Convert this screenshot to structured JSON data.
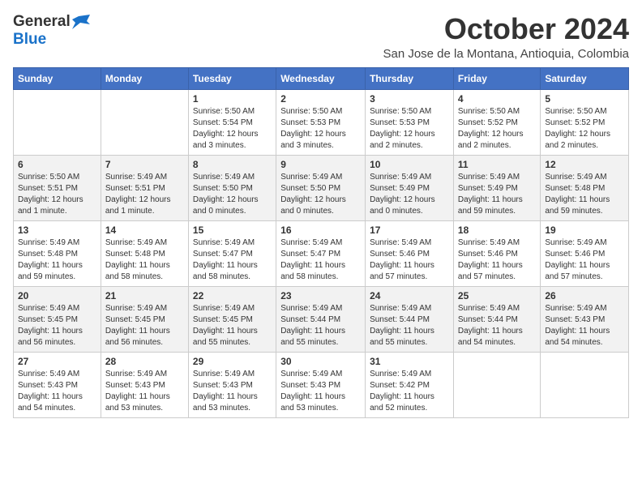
{
  "header": {
    "logo_general": "General",
    "logo_blue": "Blue",
    "month_title": "October 2024",
    "location": "San Jose de la Montana, Antioquia, Colombia"
  },
  "calendar": {
    "days_of_week": [
      "Sunday",
      "Monday",
      "Tuesday",
      "Wednesday",
      "Thursday",
      "Friday",
      "Saturday"
    ],
    "weeks": [
      [
        {
          "day": "",
          "info": ""
        },
        {
          "day": "",
          "info": ""
        },
        {
          "day": "1",
          "info": "Sunrise: 5:50 AM\nSunset: 5:54 PM\nDaylight: 12 hours\nand 3 minutes."
        },
        {
          "day": "2",
          "info": "Sunrise: 5:50 AM\nSunset: 5:53 PM\nDaylight: 12 hours\nand 3 minutes."
        },
        {
          "day": "3",
          "info": "Sunrise: 5:50 AM\nSunset: 5:53 PM\nDaylight: 12 hours\nand 2 minutes."
        },
        {
          "day": "4",
          "info": "Sunrise: 5:50 AM\nSunset: 5:52 PM\nDaylight: 12 hours\nand 2 minutes."
        },
        {
          "day": "5",
          "info": "Sunrise: 5:50 AM\nSunset: 5:52 PM\nDaylight: 12 hours\nand 2 minutes."
        }
      ],
      [
        {
          "day": "6",
          "info": "Sunrise: 5:50 AM\nSunset: 5:51 PM\nDaylight: 12 hours\nand 1 minute."
        },
        {
          "day": "7",
          "info": "Sunrise: 5:49 AM\nSunset: 5:51 PM\nDaylight: 12 hours\nand 1 minute."
        },
        {
          "day": "8",
          "info": "Sunrise: 5:49 AM\nSunset: 5:50 PM\nDaylight: 12 hours\nand 0 minutes."
        },
        {
          "day": "9",
          "info": "Sunrise: 5:49 AM\nSunset: 5:50 PM\nDaylight: 12 hours\nand 0 minutes."
        },
        {
          "day": "10",
          "info": "Sunrise: 5:49 AM\nSunset: 5:49 PM\nDaylight: 12 hours\nand 0 minutes."
        },
        {
          "day": "11",
          "info": "Sunrise: 5:49 AM\nSunset: 5:49 PM\nDaylight: 11 hours\nand 59 minutes."
        },
        {
          "day": "12",
          "info": "Sunrise: 5:49 AM\nSunset: 5:48 PM\nDaylight: 11 hours\nand 59 minutes."
        }
      ],
      [
        {
          "day": "13",
          "info": "Sunrise: 5:49 AM\nSunset: 5:48 PM\nDaylight: 11 hours\nand 59 minutes."
        },
        {
          "day": "14",
          "info": "Sunrise: 5:49 AM\nSunset: 5:48 PM\nDaylight: 11 hours\nand 58 minutes."
        },
        {
          "day": "15",
          "info": "Sunrise: 5:49 AM\nSunset: 5:47 PM\nDaylight: 11 hours\nand 58 minutes."
        },
        {
          "day": "16",
          "info": "Sunrise: 5:49 AM\nSunset: 5:47 PM\nDaylight: 11 hours\nand 58 minutes."
        },
        {
          "day": "17",
          "info": "Sunrise: 5:49 AM\nSunset: 5:46 PM\nDaylight: 11 hours\nand 57 minutes."
        },
        {
          "day": "18",
          "info": "Sunrise: 5:49 AM\nSunset: 5:46 PM\nDaylight: 11 hours\nand 57 minutes."
        },
        {
          "day": "19",
          "info": "Sunrise: 5:49 AM\nSunset: 5:46 PM\nDaylight: 11 hours\nand 57 minutes."
        }
      ],
      [
        {
          "day": "20",
          "info": "Sunrise: 5:49 AM\nSunset: 5:45 PM\nDaylight: 11 hours\nand 56 minutes."
        },
        {
          "day": "21",
          "info": "Sunrise: 5:49 AM\nSunset: 5:45 PM\nDaylight: 11 hours\nand 56 minutes."
        },
        {
          "day": "22",
          "info": "Sunrise: 5:49 AM\nSunset: 5:45 PM\nDaylight: 11 hours\nand 55 minutes."
        },
        {
          "day": "23",
          "info": "Sunrise: 5:49 AM\nSunset: 5:44 PM\nDaylight: 11 hours\nand 55 minutes."
        },
        {
          "day": "24",
          "info": "Sunrise: 5:49 AM\nSunset: 5:44 PM\nDaylight: 11 hours\nand 55 minutes."
        },
        {
          "day": "25",
          "info": "Sunrise: 5:49 AM\nSunset: 5:44 PM\nDaylight: 11 hours\nand 54 minutes."
        },
        {
          "day": "26",
          "info": "Sunrise: 5:49 AM\nSunset: 5:43 PM\nDaylight: 11 hours\nand 54 minutes."
        }
      ],
      [
        {
          "day": "27",
          "info": "Sunrise: 5:49 AM\nSunset: 5:43 PM\nDaylight: 11 hours\nand 54 minutes."
        },
        {
          "day": "28",
          "info": "Sunrise: 5:49 AM\nSunset: 5:43 PM\nDaylight: 11 hours\nand 53 minutes."
        },
        {
          "day": "29",
          "info": "Sunrise: 5:49 AM\nSunset: 5:43 PM\nDaylight: 11 hours\nand 53 minutes."
        },
        {
          "day": "30",
          "info": "Sunrise: 5:49 AM\nSunset: 5:43 PM\nDaylight: 11 hours\nand 53 minutes."
        },
        {
          "day": "31",
          "info": "Sunrise: 5:49 AM\nSunset: 5:42 PM\nDaylight: 11 hours\nand 52 minutes."
        },
        {
          "day": "",
          "info": ""
        },
        {
          "day": "",
          "info": ""
        }
      ]
    ]
  }
}
